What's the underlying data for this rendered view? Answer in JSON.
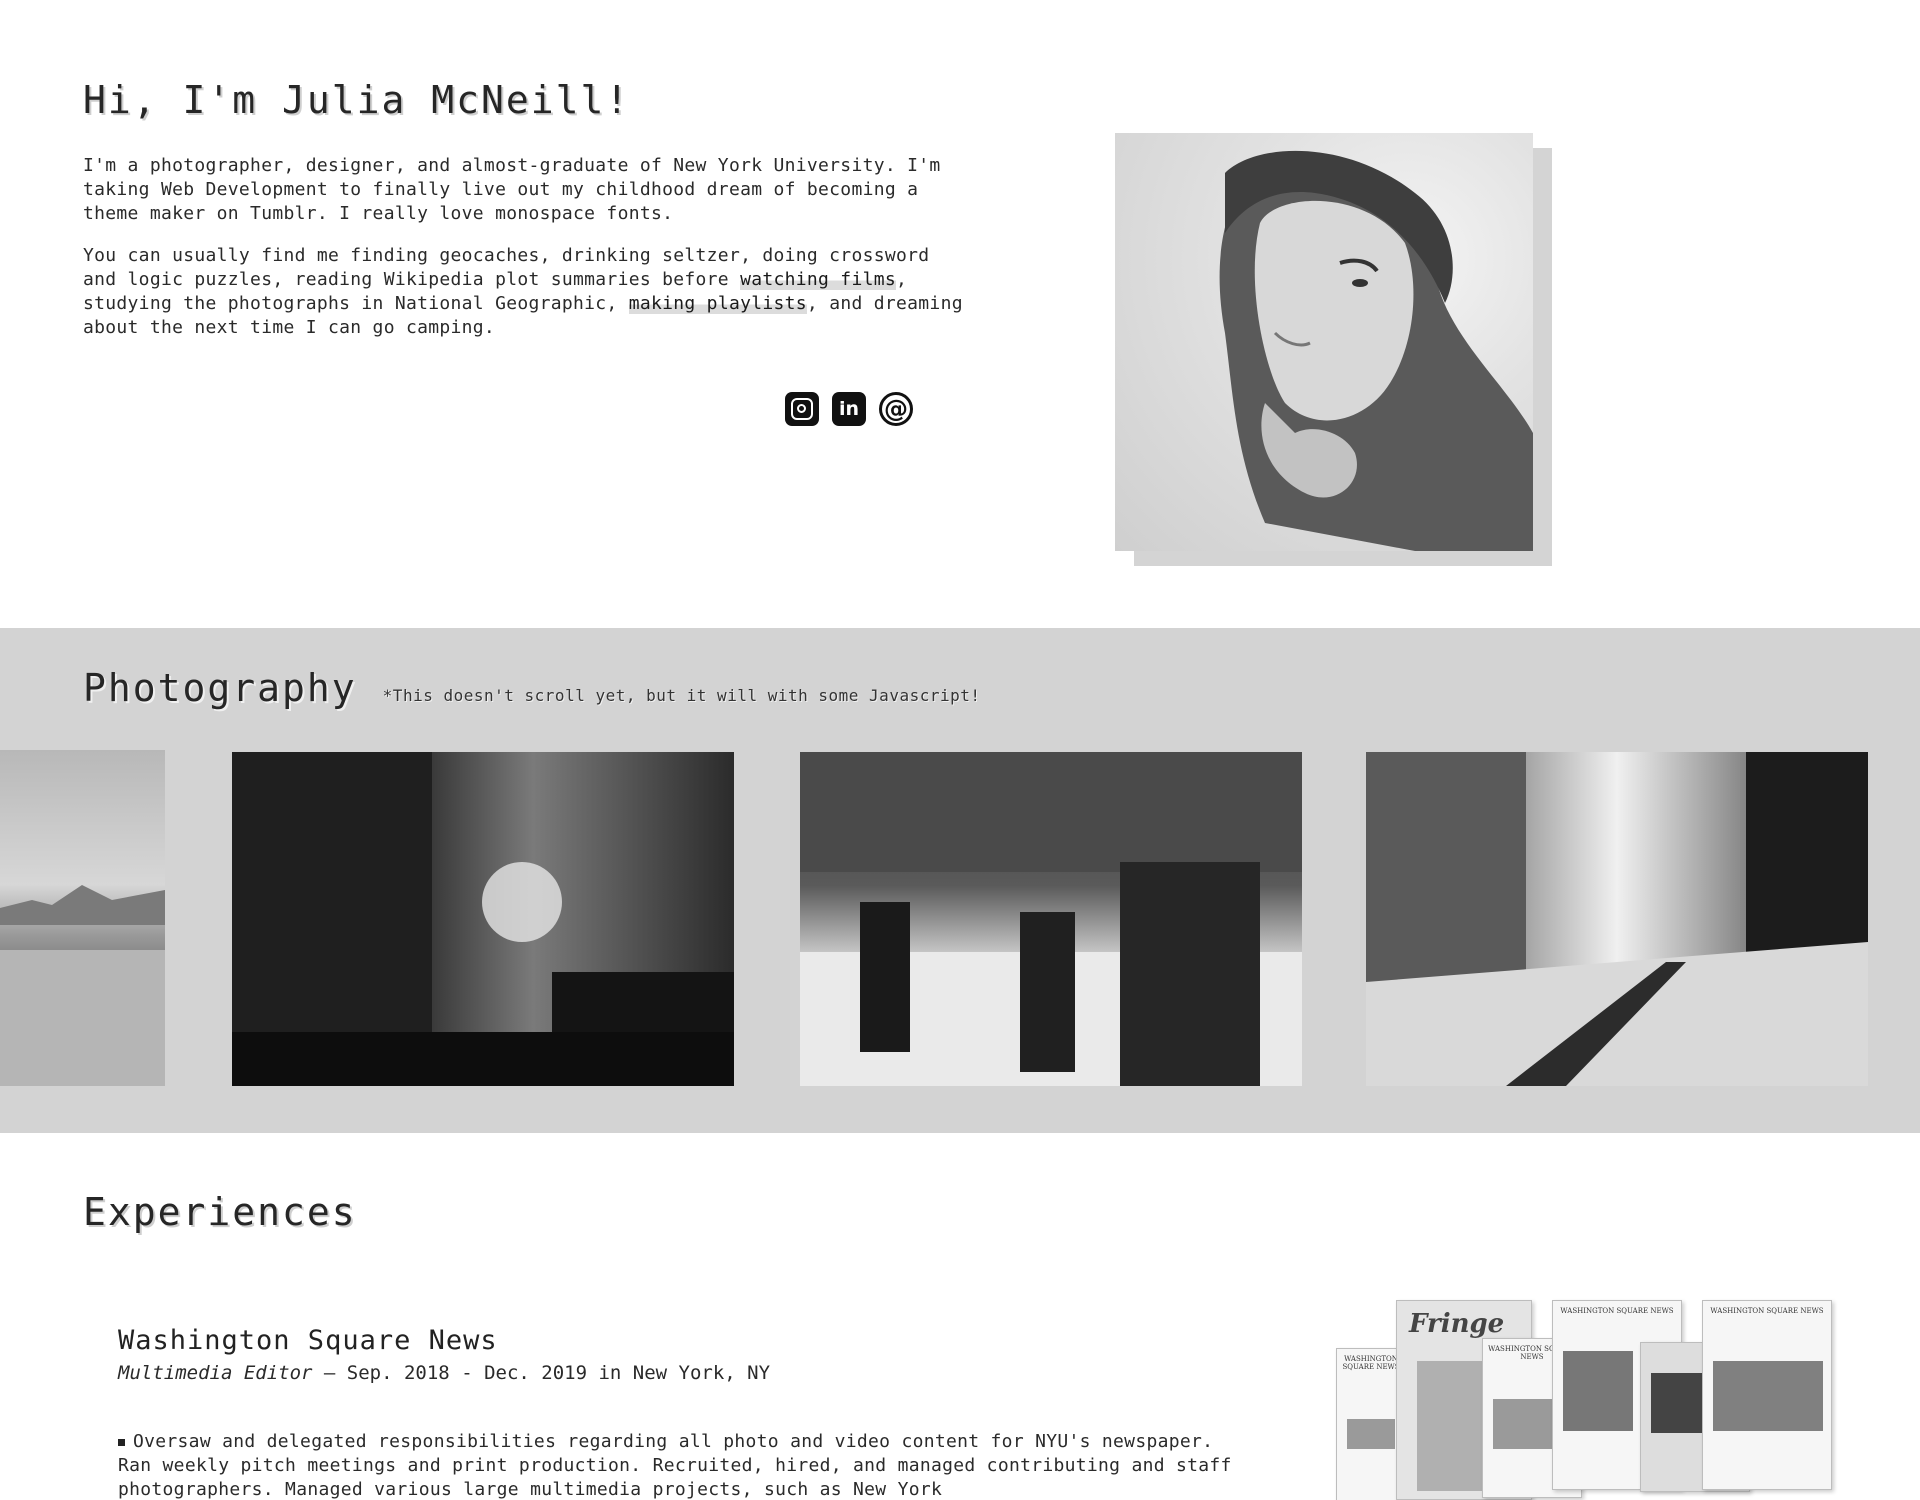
{
  "intro": {
    "heading": "Hi, I'm Julia McNeill!",
    "p1": "I'm a photographer, designer, and almost-graduate of New York University. I'm taking Web Development to finally live out my childhood dream of becoming a theme maker on Tumblr. I really love monospace fonts.",
    "p2_before": "You can usually find me finding geocaches, drinking seltzer, doing crossword and logic puzzles, reading Wikipedia plot summaries before ",
    "p2_link1": "watching films",
    "p2_mid": ", studying the photographs in National Geographic, ",
    "p2_link2": "making playlists",
    "p2_after": ", and dreaming about the next time I can go camping."
  },
  "socials": [
    {
      "icon": "instagram-icon"
    },
    {
      "icon": "linkedin-icon",
      "glyph": "in"
    },
    {
      "icon": "email-icon",
      "glyph": "@"
    }
  ],
  "photography": {
    "heading": "Photography",
    "note": "*This doesn't scroll yet, but it will with some Javascript!"
  },
  "experiences": {
    "heading": "Experiences",
    "jobs": [
      {
        "title": "Washington Square News",
        "role": "Multimedia Editor",
        "dates": "— Sep. 2018 - Dec. 2019 in New York, NY",
        "bullet": "Oversaw and delegated responsibilities regarding all photo and video content for NYU's newspaper. Ran weekly pitch meetings and print production. Recruited, hired, and managed contributing and staff photographers. Managed various large multimedia projects, such as New York"
      }
    ],
    "collage": {
      "fringe": "Fringe",
      "masthead": "WASHINGTON SQUARE NEWS"
    }
  },
  "colors": {
    "band": "#d3d3d3",
    "text": "#1e1e1e"
  }
}
